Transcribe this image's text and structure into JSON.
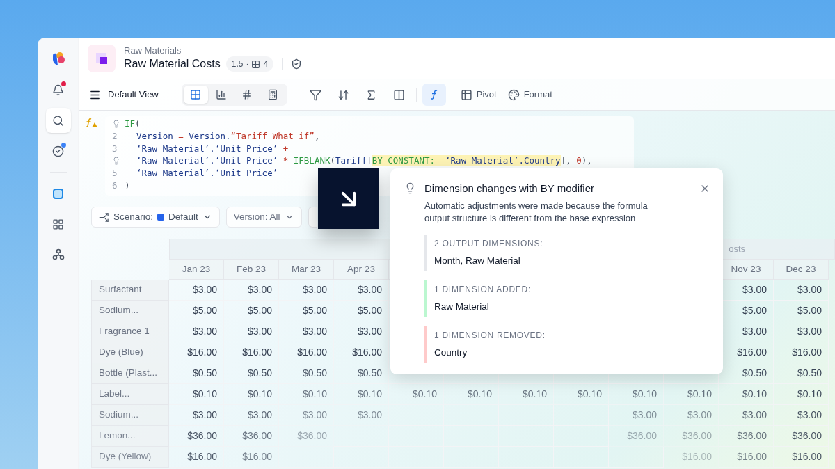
{
  "sidebar": {
    "items": [
      {
        "kind": "logo",
        "selected": false
      },
      {
        "kind": "bell",
        "selected": false,
        "color": "#e11d48"
      },
      {
        "kind": "search",
        "selected": true
      },
      {
        "kind": "check",
        "selected": false,
        "color": "#3b82f6"
      },
      {
        "kind": "divider"
      },
      {
        "kind": "square",
        "selected": false
      },
      {
        "kind": "apps",
        "selected": false
      },
      {
        "kind": "nodes",
        "selected": false
      }
    ]
  },
  "header": {
    "breadcrumb": "Raw Materials",
    "title": "Raw Material Costs",
    "version": "1.5",
    "separator": "·",
    "dimension_count": "4"
  },
  "toolbar": {
    "view_name": "Default View",
    "view_modes": [
      {
        "kind": "grid",
        "selected": true
      },
      {
        "kind": "chart",
        "selected": false
      },
      {
        "kind": "number",
        "selected": false
      },
      {
        "kind": "calculator",
        "selected": false
      }
    ],
    "tools": [
      {
        "kind": "filter",
        "selected": false
      },
      {
        "kind": "sort",
        "selected": false
      },
      {
        "kind": "sum",
        "selected": false
      },
      {
        "kind": "layout",
        "selected": false
      },
      {
        "kind": "divider"
      },
      {
        "kind": "formula",
        "selected": true
      },
      {
        "kind": "divider"
      },
      {
        "kind": "pivot",
        "label": "Pivot",
        "selected": false
      },
      {
        "kind": "format",
        "label": "Format",
        "selected": false
      }
    ]
  },
  "formula": {
    "lines": [
      {
        "kind": "hint",
        "indent": false,
        "tokens": [
          {
            "kind": "fn",
            "text": "IF"
          },
          {
            "kind": "punct",
            "text": "("
          }
        ]
      },
      {
        "kind": "number",
        "number": "2",
        "indent": true,
        "tokens": [
          {
            "kind": "ident",
            "text": "Version"
          },
          {
            "kind": "op",
            "text": " = "
          },
          {
            "kind": "ident",
            "text": "Version."
          },
          {
            "kind": "str",
            "text": "“Tariff What if”"
          },
          {
            "kind": "punct",
            "text": ","
          }
        ]
      },
      {
        "kind": "number",
        "number": "3",
        "indent": true,
        "tokens": [
          {
            "kind": "ident",
            "text": "‘Raw Material’.‘Unit Price’"
          },
          {
            "kind": "op",
            "text": " +"
          }
        ]
      },
      {
        "kind": "hint",
        "indent": true,
        "tokens": [
          {
            "kind": "ident",
            "text": "‘Raw Material’.‘Unit Price’"
          },
          {
            "kind": "op",
            "text": " * "
          },
          {
            "kind": "fn",
            "text": "IFBLANK"
          },
          {
            "kind": "punct",
            "text": "("
          },
          {
            "kind": "ident",
            "text": "Tariff"
          },
          {
            "kind": "punct",
            "text": "["
          },
          {
            "kind": "fn",
            "text": "BY CONSTANT:",
            "highlighted": true
          },
          {
            "kind": "ident",
            "text": "  ‘Raw Material’.Country",
            "highlighted": true
          },
          {
            "kind": "punct",
            "text": "], "
          },
          {
            "kind": "num",
            "text": "0"
          },
          {
            "kind": "punct",
            "text": "),"
          }
        ]
      },
      {
        "kind": "number",
        "number": "5",
        "indent": true,
        "tokens": [
          {
            "kind": "ident",
            "text": "‘Raw Material’.‘Unit Price’"
          }
        ]
      },
      {
        "kind": "number",
        "number": "6",
        "indent": false,
        "tokens": [
          {
            "kind": "punct",
            "text": ")"
          }
        ]
      }
    ]
  },
  "filters": [
    {
      "kind": "scenario",
      "label": "Scenario:",
      "value": "Default",
      "color": "#2563eb"
    },
    {
      "kind": "plain",
      "label": "Version: All"
    },
    {
      "kind": "covered"
    }
  ],
  "table": {
    "group_header": "osts",
    "columns": [
      "Jan 23",
      "Feb 23",
      "Mar 23",
      "Apr 23",
      null,
      null,
      null,
      null,
      null,
      null,
      "Nov 23",
      "Dec 23"
    ],
    "rows": [
      {
        "label": "Surfactant",
        "cells": [
          "$3.00",
          "$3.00",
          "$3.00",
          "$3.00",
          null,
          null,
          null,
          null,
          null,
          null,
          "$3.00",
          "$3.00"
        ]
      },
      {
        "label": "Sodium...",
        "cells": [
          "$5.00",
          "$5.00",
          "$5.00",
          "$5.00",
          null,
          null,
          null,
          null,
          null,
          null,
          "$5.00",
          "$5.00"
        ]
      },
      {
        "label": "Fragrance 1",
        "cells": [
          "$3.00",
          "$3.00",
          "$3.00",
          "$3.00",
          null,
          null,
          null,
          null,
          null,
          null,
          "$3.00",
          "$3.00"
        ]
      },
      {
        "label": "Dye (Blue)",
        "cells": [
          "$16.00",
          "$16.00",
          "$16.00",
          "$16.00",
          null,
          null,
          null,
          null,
          null,
          null,
          "$16.00",
          "$16.00"
        ]
      },
      {
        "label": "Bottle (Plast...",
        "cells": [
          "$0.50",
          "$0.50",
          "$0.50",
          "$0.50",
          null,
          null,
          null,
          null,
          null,
          null,
          "$0.50",
          "$0.50"
        ]
      },
      {
        "label": "Label...",
        "cells": [
          "$0.10",
          "$0.10",
          "$0.10",
          "$0.10",
          "$0.10",
          "$0.10",
          "$0.10",
          "$0.10",
          "$0.10",
          "$0.10",
          "$0.10",
          "$0.10"
        ]
      },
      {
        "label": "Sodium...",
        "cells": [
          "$3.00",
          "$3.00",
          "$3.00",
          "$3.00",
          null,
          null,
          null,
          null,
          "$3.00",
          "$3.00",
          "$3.00",
          "$3.00"
        ]
      },
      {
        "label": "Lemon...",
        "cells": [
          "$36.00",
          "$36.00",
          "$36.00",
          null,
          null,
          null,
          null,
          null,
          "$36.00",
          "$36.00",
          "$36.00",
          "$36.00"
        ]
      },
      {
        "label": "Dye (Yellow)",
        "cells": [
          "$16.00",
          "$16.00",
          null,
          null,
          null,
          null,
          null,
          null,
          null,
          "$16.00",
          "$16.00",
          "$16.00"
        ]
      }
    ]
  },
  "popup": {
    "title": "Dimension changes with BY modifier",
    "description": "Automatic adjustments were made because the formula output structure is different from the base expression",
    "sections": [
      {
        "label": "2 OUTPUT DIMENSIONS:",
        "value": "Month, Raw Material",
        "color": "#e5e7eb"
      },
      {
        "label": "1 DIMENSION ADDED:",
        "value": "Raw Material",
        "color": "#bbf7d0"
      },
      {
        "label": "1 DIMENSION REMOVED:",
        "value": "Country",
        "color": "#fecaca"
      }
    ]
  }
}
